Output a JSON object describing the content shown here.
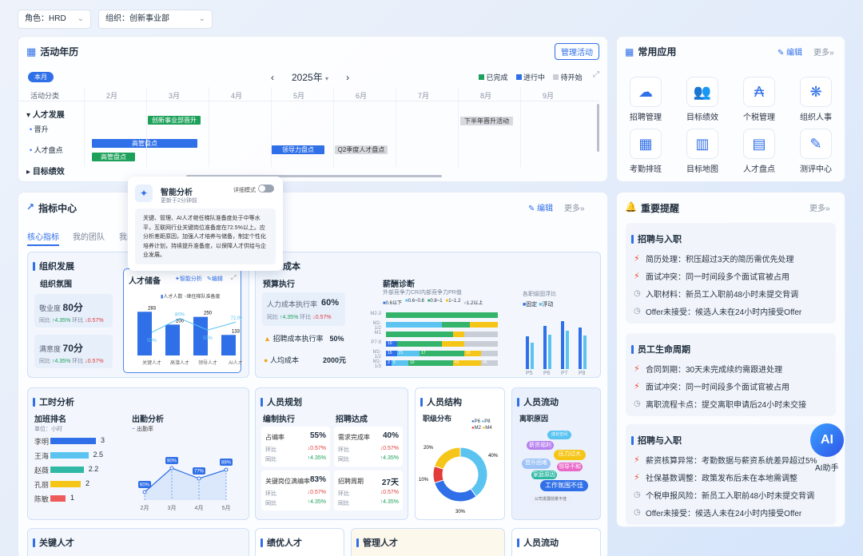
{
  "filters": {
    "role": "角色：HRD",
    "org": "组织：创新事业部"
  },
  "calendar": {
    "title": "活动年历",
    "manage": "管理活动",
    "this_month": "本月",
    "year": "2025年",
    "legend": [
      "已完成",
      "进行中",
      "待开始"
    ],
    "months": [
      "2月",
      "3月",
      "4月",
      "5月",
      "6月",
      "7月",
      "8月",
      "9月"
    ],
    "col_header": "活动分类",
    "groups": [
      "人才发展",
      "目标绩效"
    ],
    "rows": [
      "晋升",
      "人才盘点"
    ],
    "events": [
      "创新事业部晋升",
      "下半年晋升活动",
      "高管盘点",
      "高管盘点",
      "领导力盘点",
      "Q2季度人才盘点"
    ]
  },
  "apps": {
    "title": "常用应用",
    "edit": "编辑",
    "more": "更多",
    "items": [
      "招聘管理",
      "目标绩效",
      "个税管理",
      "组织人事",
      "考勤排班",
      "目标地图",
      "人才盘点",
      "测评中心"
    ]
  },
  "indicators": {
    "title": "指标中心",
    "edit": "编辑",
    "more": "更多",
    "tabs": [
      "核心指标",
      "我的团队",
      "我的"
    ]
  },
  "ai_popup": {
    "title": "智能分析",
    "updated": "更新于2分钟前",
    "mode": "详细模式",
    "text": "关键、管理、AI人才继任梯队准备度处于中等水平，互联网行业关键岗位准备度在72.5%以上。应分析差距原因，加强人才培养与储备，制定个性化培养计划，持续提升准备度，以保障人才供给与企业发展。"
  },
  "org_dev": {
    "title": "组织发展",
    "climate": "组织氛围",
    "engage": {
      "label": "敬业度",
      "value": "80分",
      "yoy": "同比",
      "yoy_v": "4.35%",
      "mom": "环比",
      "mom_v": "0.57%"
    },
    "satis": {
      "label": "满意度",
      "value": "70分",
      "yoy": "同比",
      "yoy_v": "4.35%",
      "mom": "环比",
      "mom_v": "0.57%"
    },
    "reserve": {
      "title": "人才储备",
      "ai": "智能分析",
      "edit": "编辑",
      "legend": [
        "人才人数",
        "继任梯队准备度"
      ]
    }
  },
  "reserve_chart": {
    "type": "bar",
    "categories": [
      "关键人才",
      "高潜人才",
      "领导人才",
      "AI人才"
    ],
    "values": [
      283,
      200,
      250,
      133
    ],
    "line_values": [
      50,
      80,
      55,
      72
    ],
    "pct_labels": [
      "50%",
      "80%",
      "55%",
      "72.0%"
    ]
  },
  "cost": {
    "title": "成本",
    "budget": "预算执行",
    "items": [
      {
        "label": "人力成本执行率",
        "value": "60%"
      },
      {
        "label": "招聘成本执行率",
        "value": "50%"
      },
      {
        "label": "人均成本",
        "value": "2000元"
      }
    ],
    "yoy": "同比",
    "yoy_v": "4.35%",
    "mom": "环比",
    "mom_v": "0.57%",
    "salary": "薪酬诊断",
    "salary_sub": "外部竞争力CR/内部竞争力PR值",
    "legend": [
      "0.6以下",
      "0.6~0.8",
      "0.8~1",
      "1~1.2",
      "1.2以上"
    ],
    "levels": [
      "M2-3",
      "M2-1/2",
      "M1",
      "P7-9",
      "M2-1/2",
      "M2-1/3"
    ],
    "seg_labels": [
      "10",
      "15",
      "21",
      "17",
      "10",
      "3",
      "5",
      "10",
      "41",
      "46",
      "73",
      "28"
    ],
    "dist": "各职级固浮比",
    "dist_legend": [
      "固定",
      "浮动"
    ],
    "dist_cats": [
      "P5",
      "P6",
      "P7",
      "P8"
    ]
  },
  "work": {
    "title": "工时分析",
    "ot": "加班排名",
    "unit": "单位：小时",
    "att": "出勤分析",
    "att_legend": "出勤率",
    "rank": [
      {
        "name": "李明",
        "v": "3"
      },
      {
        "name": "王海",
        "v": "2.5"
      },
      {
        "name": "赵薇",
        "v": "2.2"
      },
      {
        "name": "孔丽",
        "v": "2"
      },
      {
        "name": "陈敏",
        "v": "1"
      }
    ]
  },
  "att_chart": {
    "type": "line",
    "categories": [
      "2月",
      "3月",
      "4月",
      "5月"
    ],
    "values": [
      60,
      90,
      77,
      88
    ],
    "labels": [
      "60%",
      "90%",
      "77%",
      "88%"
    ]
  },
  "plan": {
    "title": "人员规划",
    "exec": "编制执行",
    "recruit": "招聘达成",
    "cards": [
      {
        "label": "占编率",
        "value": "55%"
      },
      {
        "label": "需求完成率",
        "value": "40%"
      },
      {
        "label": "关键岗位满编率",
        "value": "83%"
      },
      {
        "label": "招聘周期",
        "value": "27天"
      }
    ],
    "mom": "环比",
    "mom_v": "0.57%",
    "yoy": "同比",
    "yoy_v": "4.35%"
  },
  "structure": {
    "title": "人员结构",
    "sub": "职级分布",
    "legend": [
      "P6",
      "P8",
      "M2",
      "M4"
    ],
    "labels": [
      "40%",
      "30%",
      "10%",
      "20%"
    ]
  },
  "structure_chart": {
    "type": "pie",
    "categories": [
      "P6",
      "P8",
      "M2",
      "M4"
    ],
    "values": [
      40,
      30,
      10,
      20
    ]
  },
  "flow": {
    "title": "人员流动",
    "sub": "离职原因",
    "words": [
      "薪资福利",
      "压力过大",
      "晋升困难",
      "领导不和",
      "家庭原因",
      "工作氛围不佳",
      "公司发展前景不佳",
      "成长空间"
    ]
  },
  "bottom": [
    "关键人才",
    "绩优人才",
    "管理人才",
    "人员流动"
  ],
  "reminders": {
    "title": "重要提醒",
    "more": "更多",
    "groups": [
      {
        "title": "招聘与入职",
        "items": [
          {
            "icon": "bolt",
            "text": "简历处理：积压超过3天的简历需优先处理"
          },
          {
            "icon": "bolt",
            "text": "面试冲突：同一时间段多个面试官被占用"
          },
          {
            "icon": "clock",
            "text": "入职材料：新员工入职前48小时未提交背调"
          },
          {
            "icon": "clock",
            "text": "Offer未接受：候选人未在24小时内接受Offer"
          }
        ]
      },
      {
        "title": "员工生命周期",
        "items": [
          {
            "icon": "bolt",
            "text": "合同到期：30天未完成续约需跟进处理"
          },
          {
            "icon": "bolt",
            "text": "面试冲突：同一时间段多个面试官被占用"
          },
          {
            "icon": "clock",
            "text": "离职流程卡点：提交离职申请后24小时未交接"
          }
        ]
      },
      {
        "title": "招聘与入职",
        "items": [
          {
            "icon": "bolt",
            "text": "薪资核算异常：考勤数据与薪资系统差异超过5%"
          },
          {
            "icon": "bolt",
            "text": "社保基数调整：政策发布后未在本地需调整"
          },
          {
            "icon": "clock",
            "text": "个税申报风险：新员工入职前48小时未提交背调"
          },
          {
            "icon": "clock",
            "text": "Offer未接受：候选人未在24小时内接受Offer"
          }
        ]
      }
    ]
  },
  "ai_assistant": {
    "label": "AI助手",
    "badge": "AI"
  },
  "colors": {
    "accent": "#2f6fe8",
    "done": "#1da15a",
    "progress": "#2f6fe8",
    "pending": "#c9ced6"
  }
}
